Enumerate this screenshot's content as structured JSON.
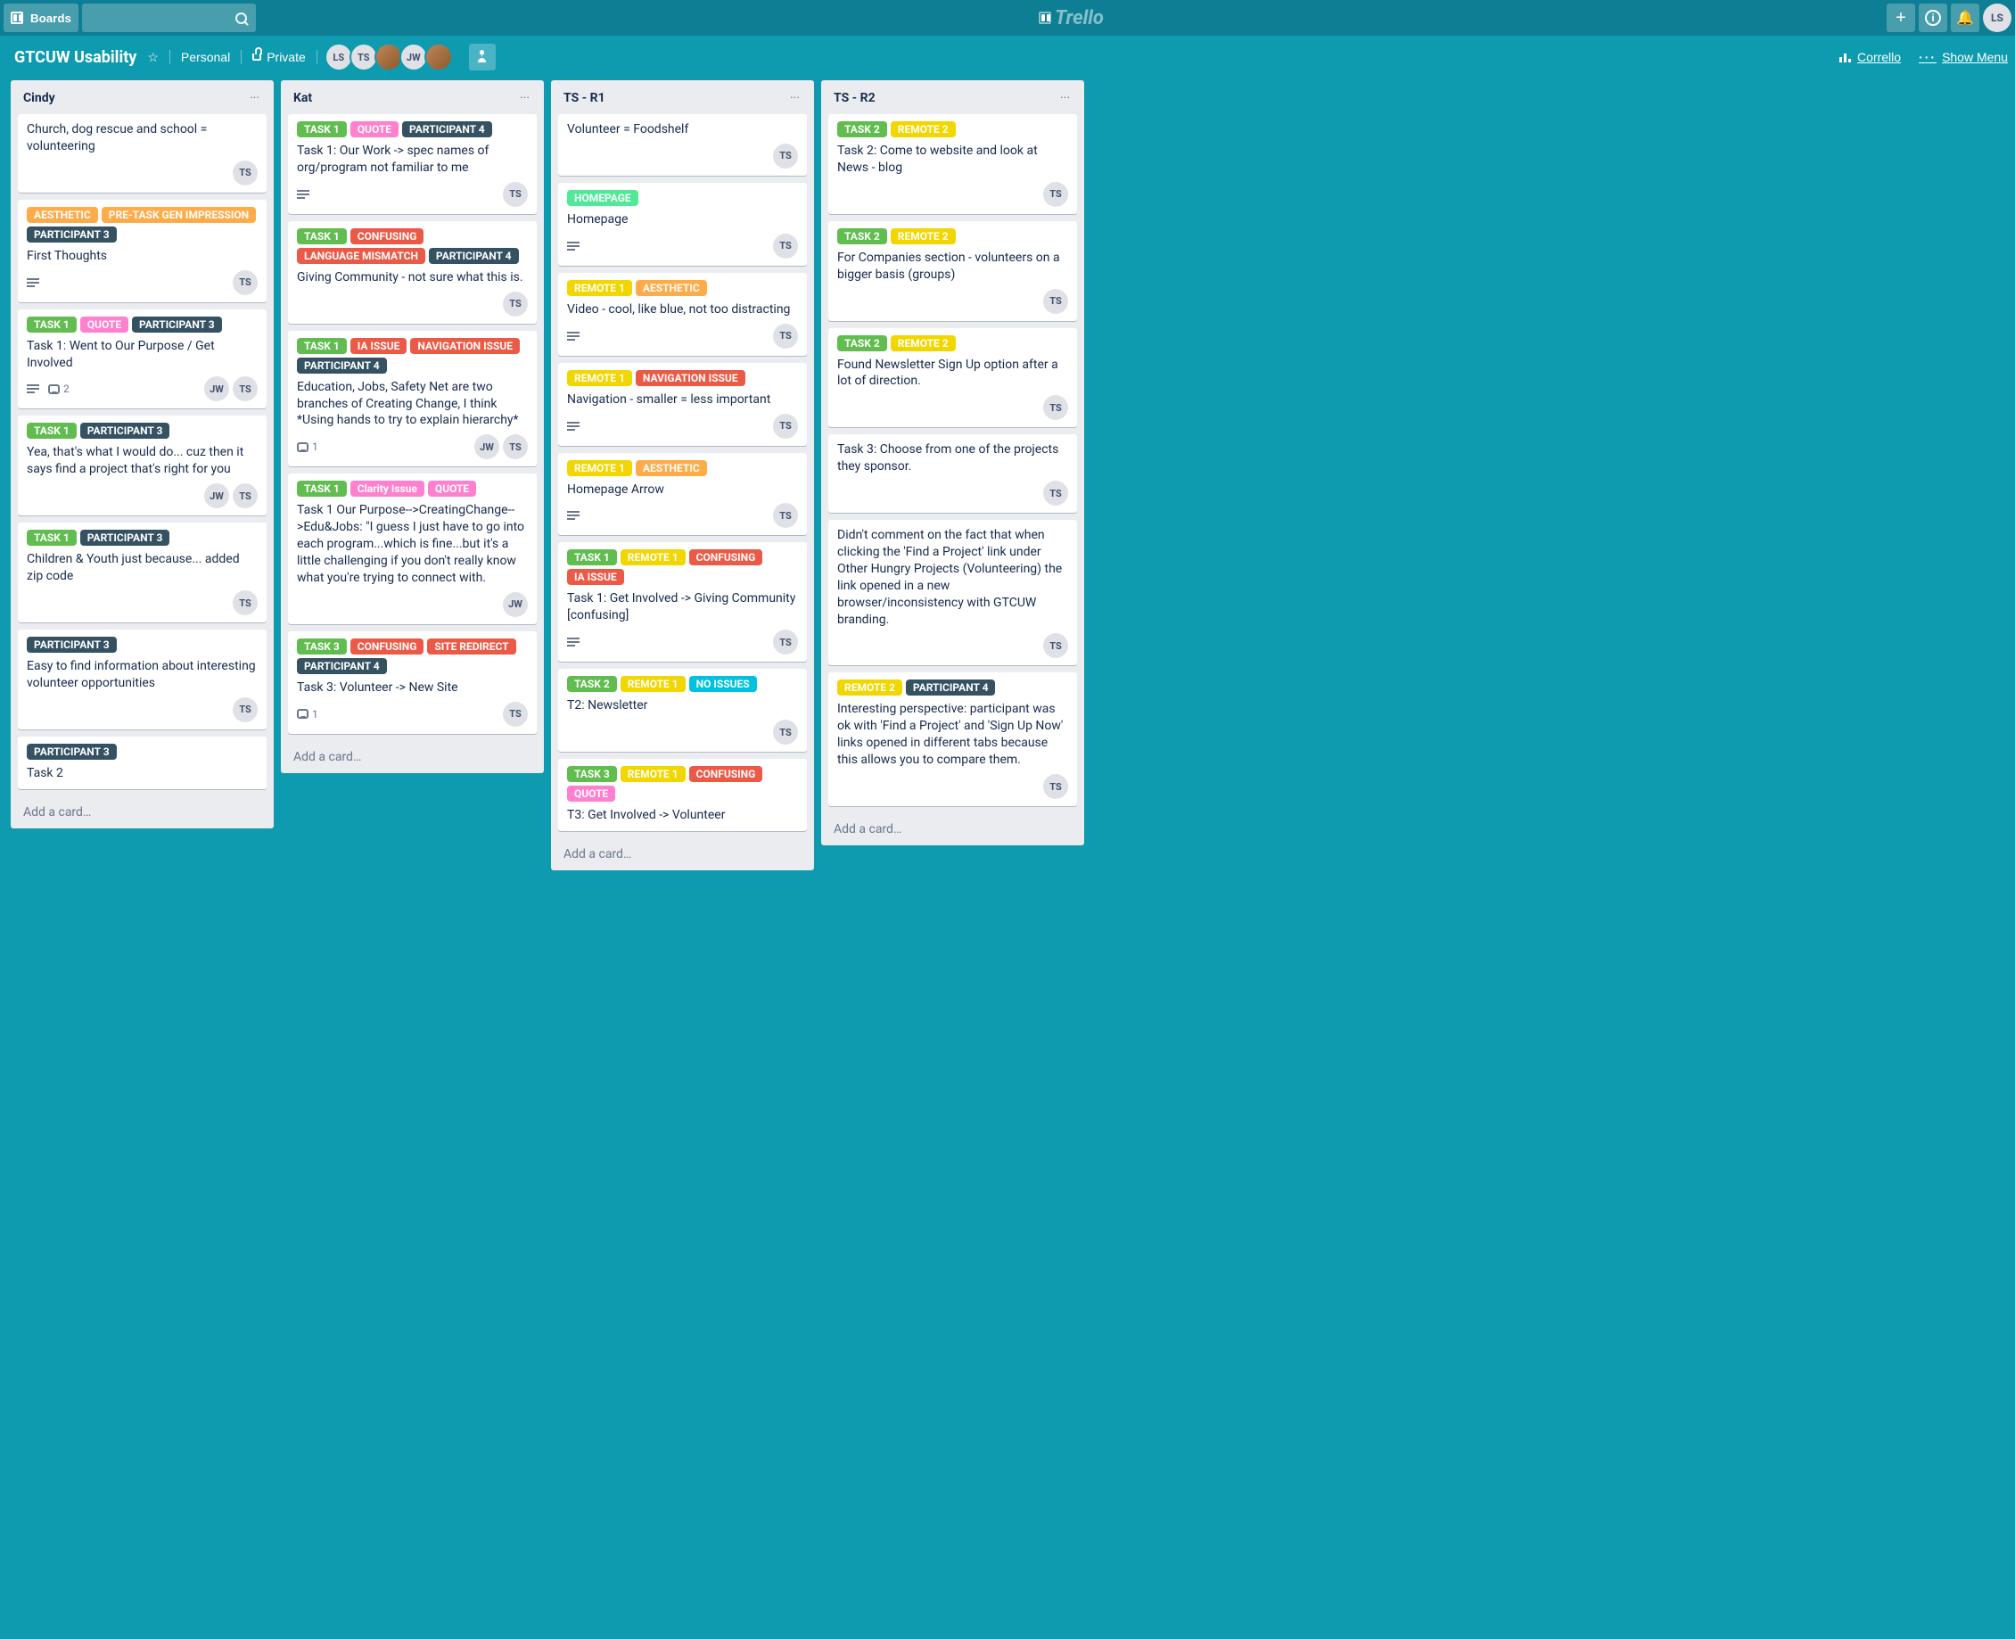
{
  "label_colors": {
    "TASK 1": "#61bd4f",
    "TASK 2": "#61bd4f",
    "TASK 3": "#61bd4f",
    "QUOTE": "#ff80ce",
    "Clarity Issue": "#ff80ce",
    "PARTICIPANT 4": "#355263",
    "PARTICIPANT 3": "#355263",
    "AESTHETIC": "#ffab4a",
    "PRE-TASK GEN IMPRESSION": "#ffab4a",
    "REMOTE 1": "#f2d600",
    "REMOTE 2": "#f2d600",
    "CONFUSING": "#eb5a46",
    "LANGUAGE MISMATCH": "#eb5a46",
    "NAVIGATION ISSUE": "#eb5a46",
    "IA ISSUE": "#eb5a46",
    "SITE REDIRECT": "#eb5a46",
    "HOMEPAGE": "#51e898",
    "NO ISSUES": "#00c2e0"
  },
  "header": {
    "boards": "Boards",
    "logo": "Trello",
    "user": "LS"
  },
  "board_header": {
    "title": "GTCUW Usability",
    "visibility_personal": "Personal",
    "visibility_private": "Private",
    "members": [
      "LS",
      "TS",
      "img",
      "JW",
      "img"
    ],
    "corrello": "Corrello",
    "show_menu": "Show Menu"
  },
  "add_card_text": "Add a card…",
  "lists": [
    {
      "title": "Cindy",
      "cards": [
        {
          "labels": [],
          "title": "Church, dog rescue and school = volunteering",
          "desc": false,
          "comments": 0,
          "members": [
            "TS"
          ]
        },
        {
          "labels": [
            "AESTHETIC",
            "PRE-TASK GEN IMPRESSION",
            "PARTICIPANT 3"
          ],
          "title": "First Thoughts",
          "desc": true,
          "comments": 0,
          "members": [
            "TS"
          ]
        },
        {
          "labels": [
            "TASK 1",
            "QUOTE",
            "PARTICIPANT 3"
          ],
          "title": "Task 1: Went to Our Purpose / Get Involved",
          "desc": true,
          "comments": 2,
          "members": [
            "JW",
            "TS"
          ]
        },
        {
          "labels": [
            "TASK 1",
            "PARTICIPANT 3"
          ],
          "title": "Yea, that's what I would do... cuz then it says find a project that's right for you",
          "desc": false,
          "comments": 0,
          "members": [
            "JW",
            "TS"
          ]
        },
        {
          "labels": [
            "TASK 1",
            "PARTICIPANT 3"
          ],
          "title": "Children & Youth just because... added zip code",
          "desc": false,
          "comments": 0,
          "members": [
            "TS"
          ]
        },
        {
          "labels": [
            "PARTICIPANT 3"
          ],
          "title": "Easy to find information about interesting volunteer opportunities",
          "desc": false,
          "comments": 0,
          "members": [
            "TS"
          ]
        },
        {
          "labels": [
            "PARTICIPANT 3"
          ],
          "title": "Task 2",
          "desc": false,
          "comments": 0,
          "members": []
        }
      ]
    },
    {
      "title": "Kat",
      "cards": [
        {
          "labels": [
            "TASK 1",
            "QUOTE",
            "PARTICIPANT 4"
          ],
          "title": "Task 1: Our Work -> spec names of org/program not familiar to me",
          "desc": true,
          "comments": 0,
          "members": [
            "TS"
          ]
        },
        {
          "labels": [
            "TASK 1",
            "CONFUSING",
            "LANGUAGE MISMATCH",
            "PARTICIPANT 4"
          ],
          "title": "Giving Community - not sure what this is.",
          "desc": false,
          "comments": 0,
          "members": [
            "TS"
          ]
        },
        {
          "labels": [
            "TASK 1",
            "IA ISSUE",
            "NAVIGATION ISSUE",
            "PARTICIPANT 4"
          ],
          "title": "Education, Jobs, Safety Net are two branches of Creating Change, I think *Using hands to try to explain hierarchy*",
          "desc": false,
          "comments": 1,
          "members": [
            "JW",
            "TS"
          ]
        },
        {
          "labels": [
            "TASK 1",
            "Clarity Issue",
            "QUOTE"
          ],
          "title": "Task 1 Our Purpose-->CreatingChange-->Edu&Jobs: \"I guess I just have to go into each program...which is fine...but it's a little challenging if you don't really know what you're trying to connect with.",
          "desc": false,
          "comments": 0,
          "members": [
            "JW"
          ]
        },
        {
          "labels": [
            "TASK 3",
            "CONFUSING",
            "SITE REDIRECT",
            "PARTICIPANT 4"
          ],
          "title": "Task 3: Volunteer -> New Site",
          "desc": false,
          "comments": 1,
          "members": [
            "TS"
          ]
        }
      ]
    },
    {
      "title": "TS - R1",
      "cards": [
        {
          "labels": [],
          "title": "Volunteer = Foodshelf",
          "desc": false,
          "comments": 0,
          "members": [
            "TS"
          ]
        },
        {
          "labels": [
            "HOMEPAGE"
          ],
          "title": "Homepage",
          "desc": true,
          "comments": 0,
          "members": [
            "TS"
          ]
        },
        {
          "labels": [
            "REMOTE 1",
            "AESTHETIC"
          ],
          "title": "Video - cool, like blue, not too distracting",
          "desc": true,
          "comments": 0,
          "members": [
            "TS"
          ]
        },
        {
          "labels": [
            "REMOTE 1",
            "NAVIGATION ISSUE"
          ],
          "title": "Navigation - smaller = less important",
          "desc": true,
          "comments": 0,
          "members": [
            "TS"
          ]
        },
        {
          "labels": [
            "REMOTE 1",
            "AESTHETIC"
          ],
          "title": "Homepage Arrow",
          "desc": true,
          "comments": 0,
          "members": [
            "TS"
          ]
        },
        {
          "labels": [
            "TASK 1",
            "REMOTE 1",
            "CONFUSING",
            "IA ISSUE"
          ],
          "title": "Task 1: Get Involved -> Giving Community [confusing]",
          "desc": true,
          "comments": 0,
          "members": [
            "TS"
          ]
        },
        {
          "labels": [
            "TASK 2",
            "REMOTE 1",
            "NO ISSUES"
          ],
          "title": "T2: Newsletter",
          "desc": false,
          "comments": 0,
          "members": [
            "TS"
          ]
        },
        {
          "labels": [
            "TASK 3",
            "REMOTE 1",
            "CONFUSING",
            "QUOTE"
          ],
          "title": "T3: Get Involved -> Volunteer",
          "desc": false,
          "comments": 0,
          "members": []
        }
      ]
    },
    {
      "title": "TS - R2",
      "cards": [
        {
          "labels": [
            "TASK 2",
            "REMOTE 2"
          ],
          "title": "Task 2: Come to website and look at News - blog",
          "desc": false,
          "comments": 0,
          "members": [
            "TS"
          ]
        },
        {
          "labels": [
            "TASK 2",
            "REMOTE 2"
          ],
          "title": "For Companies section - volunteers on a bigger basis (groups)",
          "desc": false,
          "comments": 0,
          "members": [
            "TS"
          ]
        },
        {
          "labels": [
            "TASK 2",
            "REMOTE 2"
          ],
          "title": "Found Newsletter Sign Up option after a lot of direction.",
          "desc": false,
          "comments": 0,
          "members": [
            "TS"
          ]
        },
        {
          "labels": [],
          "title": "Task 3: Choose from one of the projects they sponsor.",
          "desc": false,
          "comments": 0,
          "members": [
            "TS"
          ]
        },
        {
          "labels": [],
          "title": "Didn't comment on the fact that when clicking the 'Find a Project' link under Other Hungry Projects (Volunteering) the link opened in a new browser/inconsistency with GTCUW branding.",
          "desc": false,
          "comments": 0,
          "members": [
            "TS"
          ]
        },
        {
          "labels": [
            "REMOTE 2",
            "PARTICIPANT 4"
          ],
          "title": "Interesting perspective: participant was ok with 'Find a Project' and 'Sign Up Now' links opened in different tabs because this allows you to compare them.",
          "desc": false,
          "comments": 0,
          "members": [
            "TS"
          ]
        }
      ]
    }
  ]
}
